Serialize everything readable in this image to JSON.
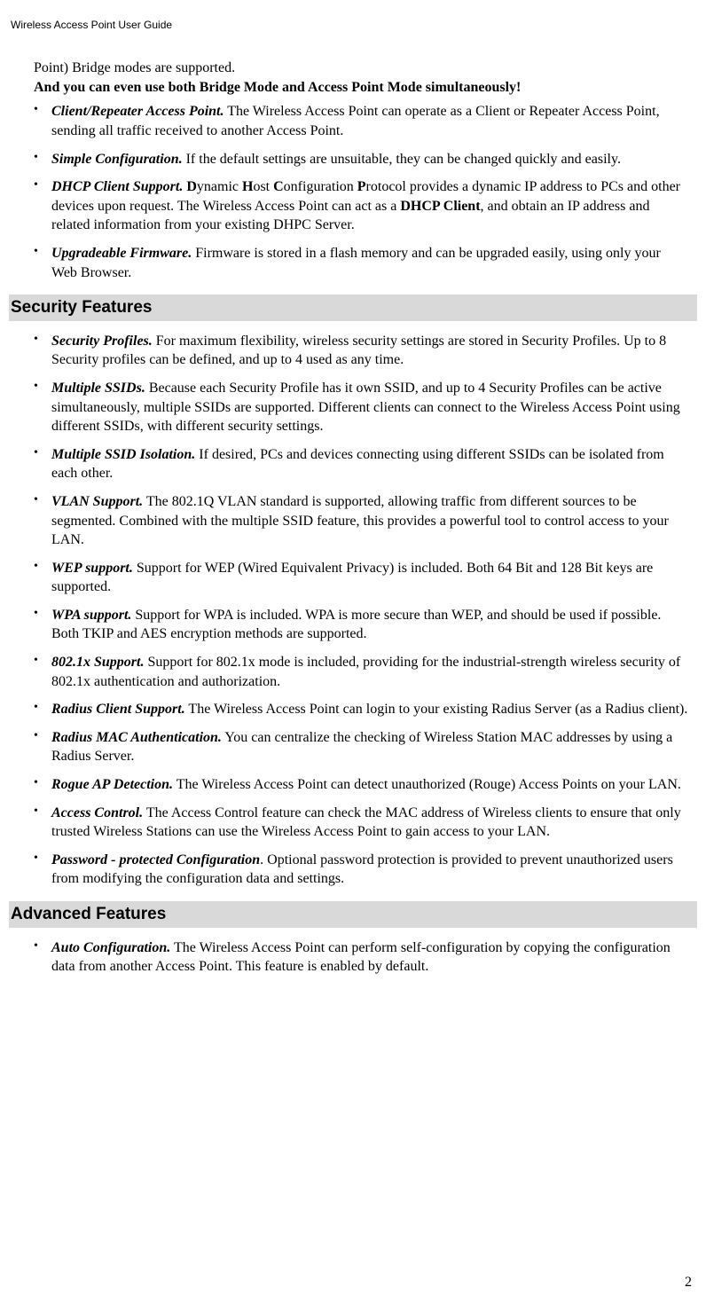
{
  "header": {
    "text": "Wireless Access Point User Guide"
  },
  "prev": {
    "line1": "Point) Bridge modes are supported.",
    "line2": "And you can even use both Bridge Mode and Access Point Mode simultaneously!"
  },
  "top_features": [
    {
      "title": "Client/Repeater Access Point.",
      "body": "  The Wireless Access Point can operate as a Client or Repeater Access Point, sending all traffic received to another Access Point."
    },
    {
      "title": "Simple Configuration.",
      "body": "  If the default settings are unsuitable, they can be changed quickly and easily."
    },
    {
      "title": "DHCP Client Support.",
      "body_html": "  <span class=\"bold-inline\">D</span>ynamic <span class=\"bold-inline\">H</span>ost <span class=\"bold-inline\">C</span>onfiguration <span class=\"bold-inline\">P</span>rotocol provides a dynamic IP address to PCs and other devices upon request. The Wireless Access Point can act as a <span class=\"bold-inline\">DHCP Client</span>, and obtain an IP address and related information from your existing DHPC Server."
    },
    {
      "title": "Upgradeable Firmware.",
      "body": "  Firmware is stored in a flash memory and can be upgraded easily, using only your Web Browser."
    }
  ],
  "sections": [
    {
      "heading": "Security Features",
      "features": [
        {
          "title": "Security Profiles.",
          "body": "  For maximum flexibility, wireless security settings are stored in Security Profiles. Up to 8 Security profiles can be defined, and up to 4 used as any time."
        },
        {
          "title": "Multiple SSIDs.",
          "body": "  Because each Security Profile has it own SSID, and up to 4 Security Profiles can be active simultaneously, multiple SSIDs are supported. Different clients can connect to the Wireless Access Point using different SSIDs, with different security set­tings."
        },
        {
          "title": "Multiple SSID Isolation.",
          "body": "  If desired, PCs and devices connecting using different SSIDs can be isolated from each other."
        },
        {
          "title": "VLAN Support.",
          "body": "  The 802.1Q VLAN standard is supported, allowing traffic from differ­ent sources to be segmented. Combined with the multiple SSID feature, this provides a powerful tool to control access to your LAN."
        },
        {
          "title": "WEP support.",
          "body": "  Support for WEP (Wired Equivalent Privacy) is included. Both 64 Bit and 128 Bit keys are supported."
        },
        {
          "title": "WPA support.",
          "body": "  Support for WPA is included. WPA is more secure than WEP, and should be used if possible. Both TKIP and AES encryption methods are supported."
        },
        {
          "title": "802.1x Support.",
          "body": "  Support for 802.1x mode is included, providing for the industrial-strength wireless security of 802.1x authentication and authorization."
        },
        {
          "title": "Radius Client Support.",
          "body": "  The Wireless Access Point can login to your existing Radius Server (as a Radius client)."
        },
        {
          "title": "Radius MAC Authentication.",
          "body": "  You can centralize the checking of Wireless Station MAC addresses by using a Radius Server."
        },
        {
          "title": "Rogue AP Detection.",
          "body": "  The Wireless Access Point can detect unauthorized (Rouge) Access Points on your LAN."
        },
        {
          "title": "Access Control.",
          "body": "  The Access Control feature can check the MAC address of Wireless clients to ensure that only trusted Wireless Stations can use the Wireless Access Point to gain access to your LAN."
        },
        {
          "title": "Password - protected Configuration",
          "title_suffix": ".",
          "body": "  Optional password protection is provided to prevent unauthorized users from modifying the configuration data and settings."
        }
      ]
    },
    {
      "heading": "Advanced Features",
      "features": [
        {
          "title": "Auto Configuration.",
          "body": "  The Wireless Access Point can perform self-configuration by copying the configuration data from another Access Point. This feature is enabled by de­fault."
        }
      ]
    }
  ],
  "page_number": "2"
}
